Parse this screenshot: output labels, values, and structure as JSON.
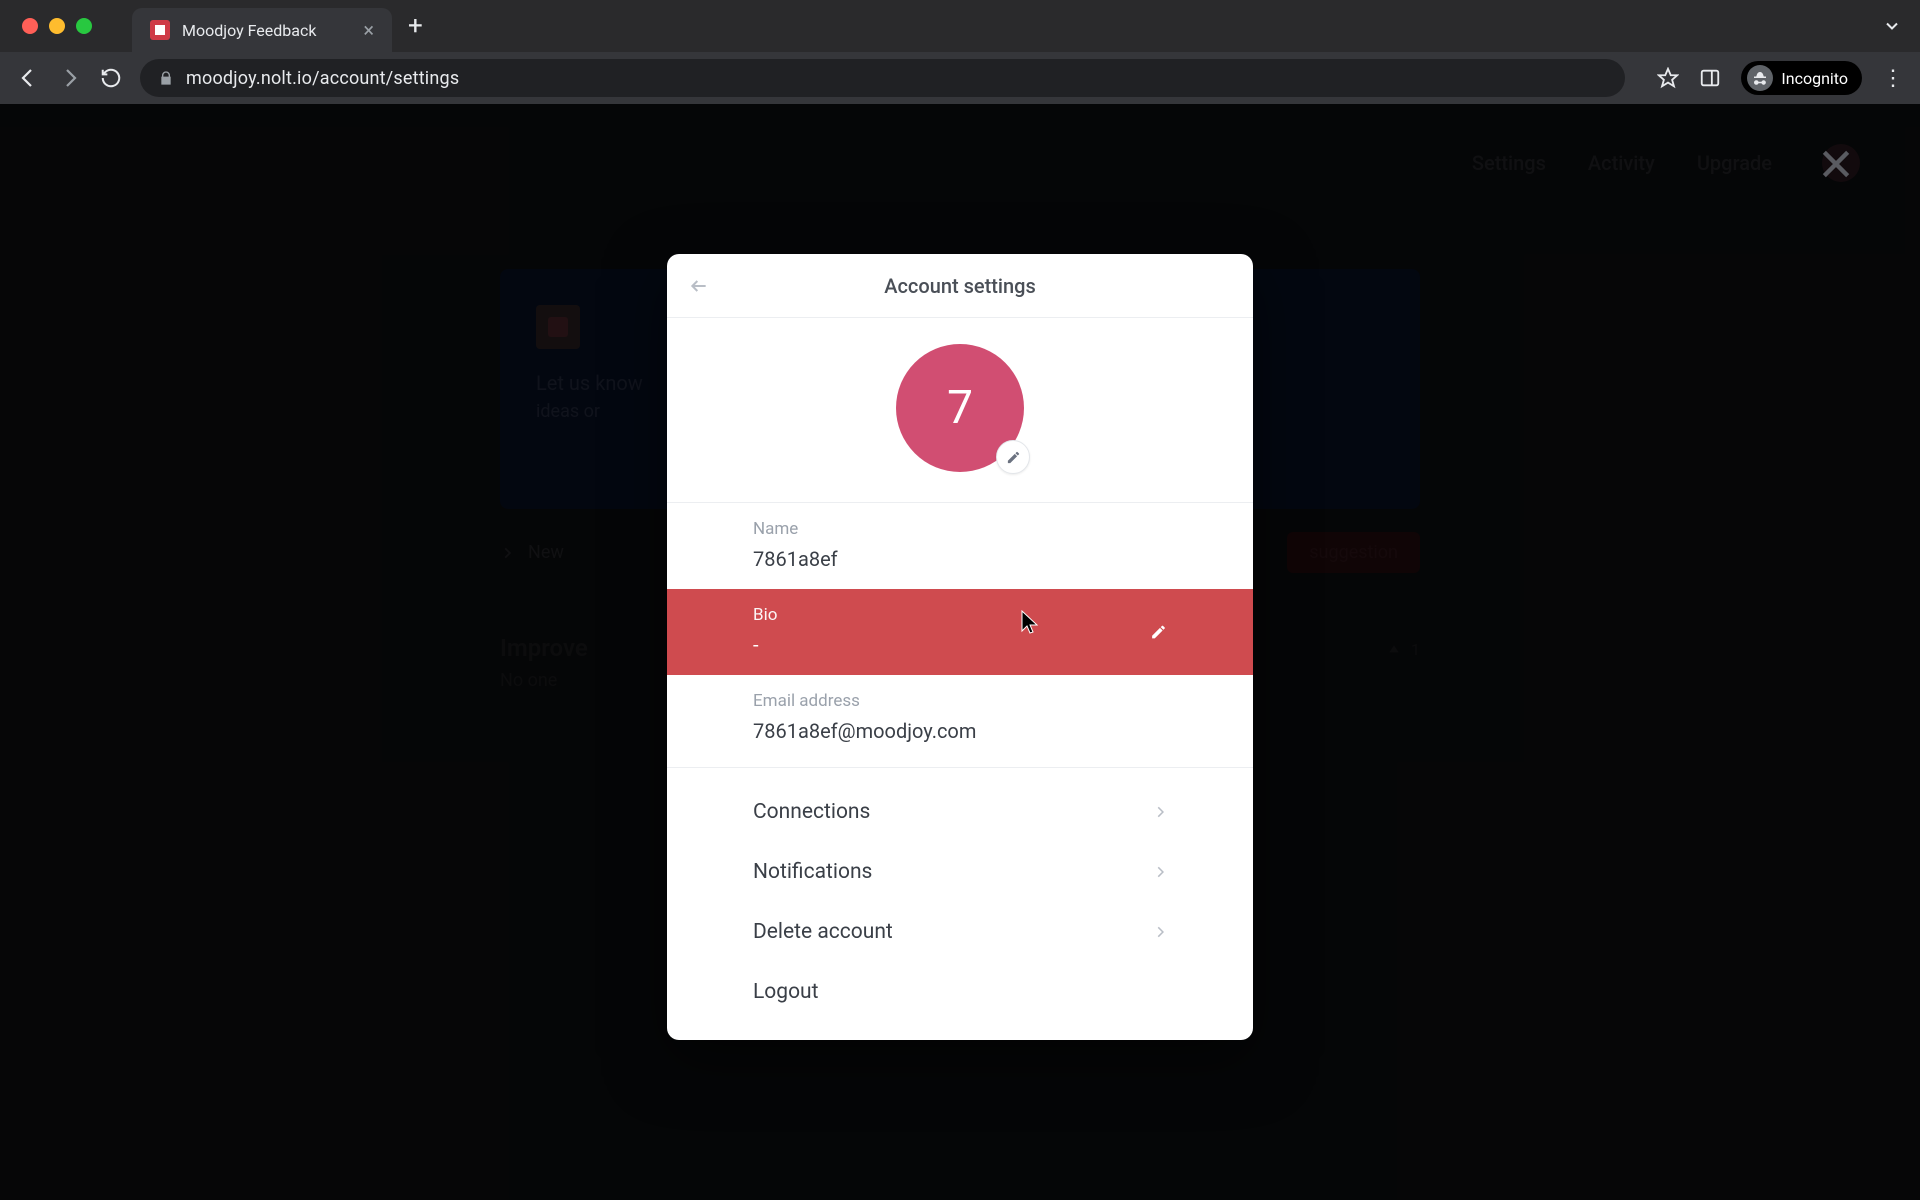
{
  "browser": {
    "tab_title": "Moodjoy Feedback",
    "url": "moodjoy.nolt.io/account/settings",
    "incognito_label": "Incognito"
  },
  "bg": {
    "nav": {
      "settings": "Settings",
      "activity": "Activity",
      "upgrade": "Upgrade"
    },
    "card": {
      "line1": "Let us know",
      "line2": "ideas or"
    },
    "toolbar": {
      "sort": "New",
      "button": "suggestion"
    },
    "post": {
      "title": "Improve",
      "subtitle": "No one",
      "votes": "1"
    }
  },
  "modal": {
    "title": "Account settings",
    "avatar_initial": "7",
    "fields": {
      "name": {
        "label": "Name",
        "value": "7861a8ef"
      },
      "bio": {
        "label": "Bio",
        "value": "-"
      },
      "email": {
        "label": "Email address",
        "value": "7861a8ef@moodjoy.com"
      }
    },
    "menu": {
      "connections": "Connections",
      "notifications": "Notifications",
      "delete": "Delete account",
      "logout": "Logout"
    }
  }
}
